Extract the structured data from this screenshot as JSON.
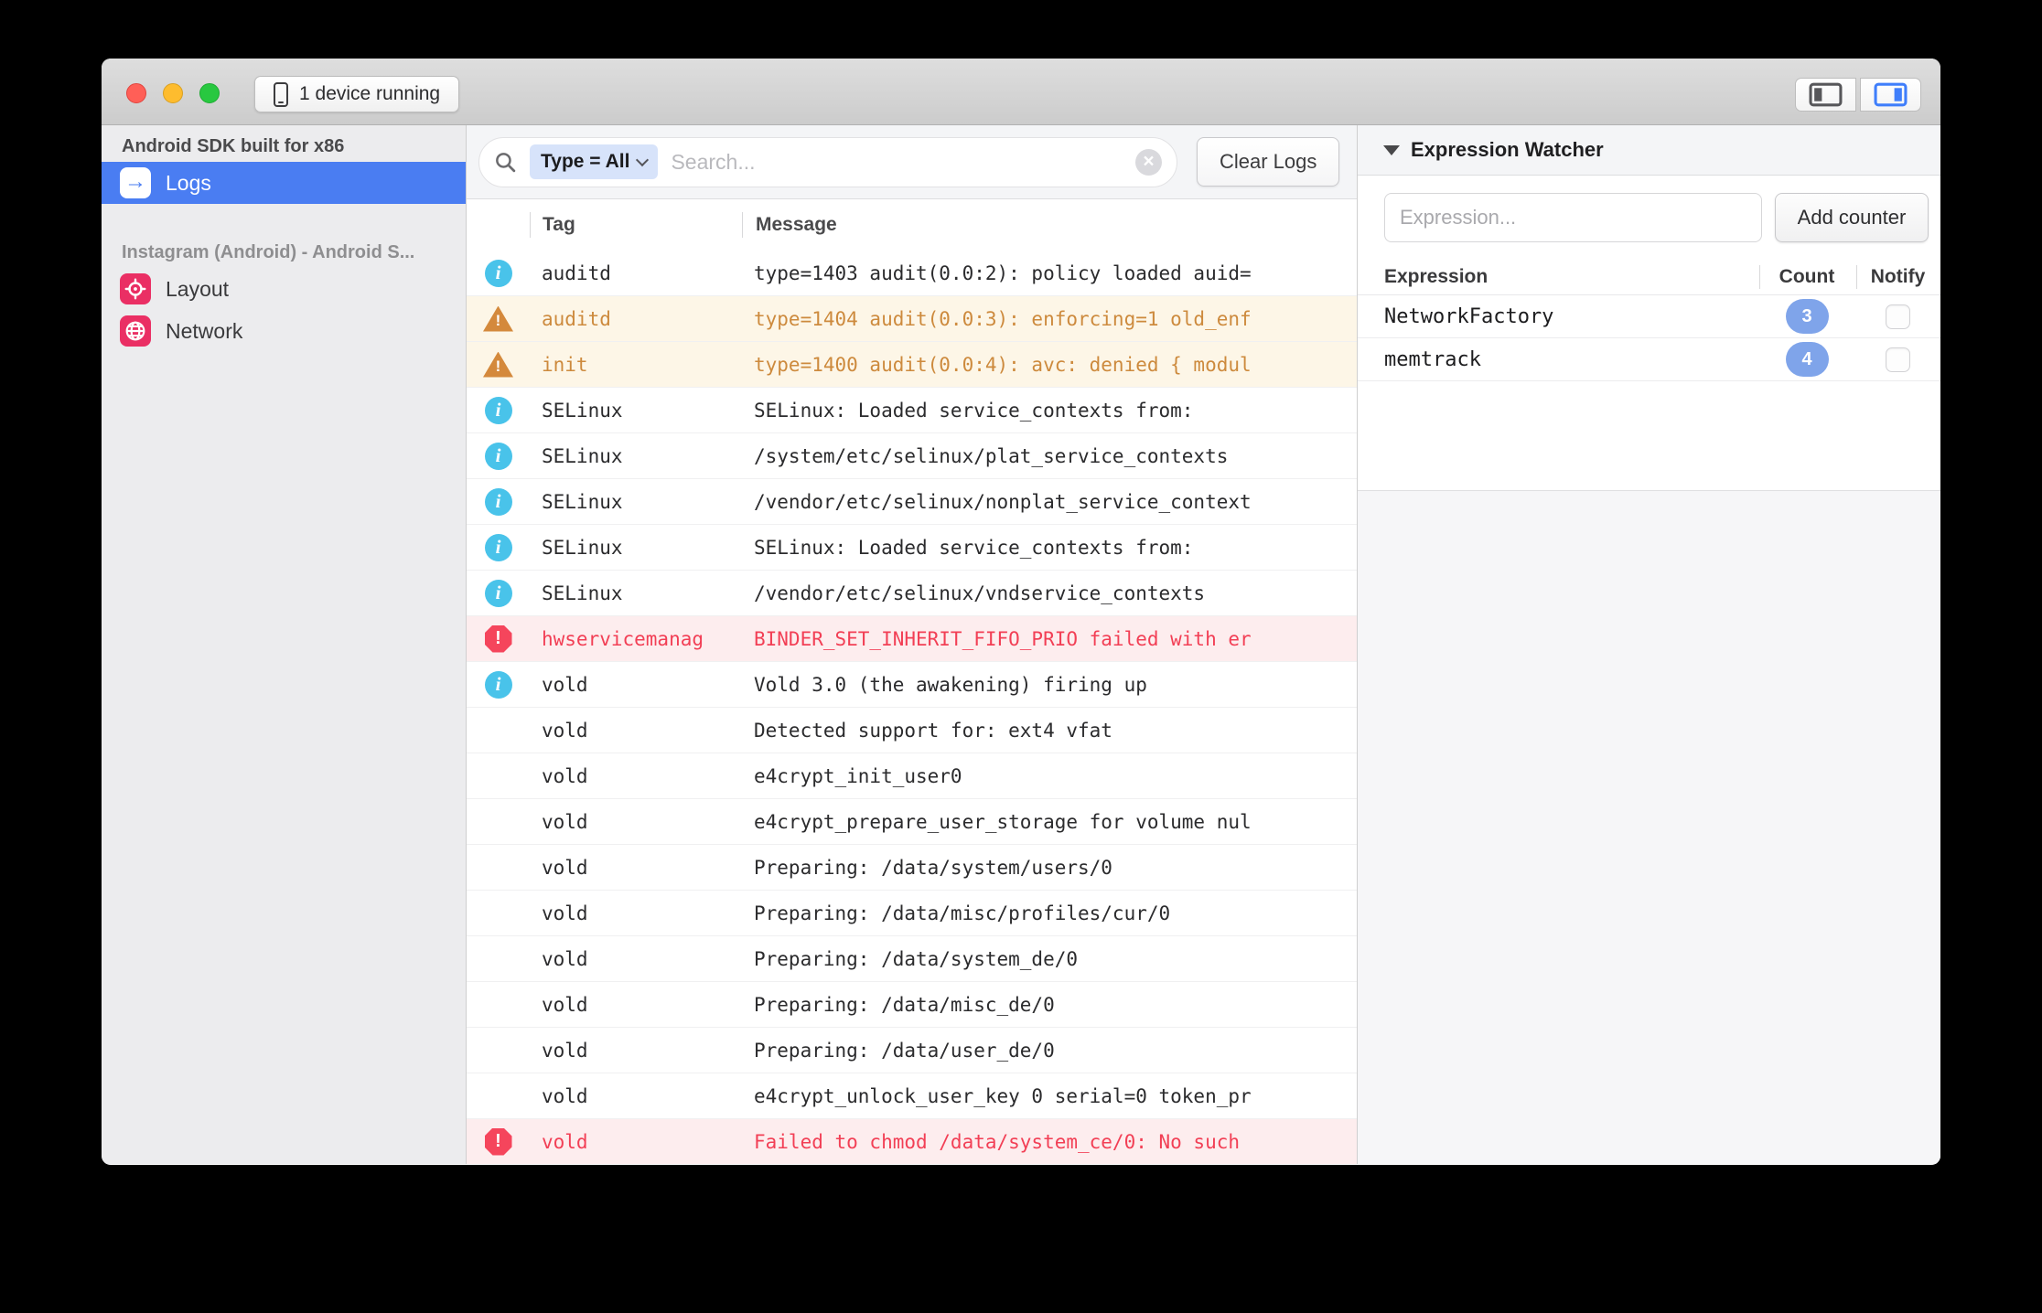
{
  "titlebar": {
    "device_button_label": "1 device running"
  },
  "sidebar": {
    "device_header": "Android SDK built for x86",
    "logs_label": "Logs",
    "app_header": "Instagram (Android) - Android S...",
    "layout_label": "Layout",
    "network_label": "Network"
  },
  "toolbar": {
    "filter_chip_label": "Type = All",
    "search_placeholder": "Search...",
    "clear_logs_label": "Clear Logs"
  },
  "log_table": {
    "columns": {
      "tag": "Tag",
      "message": "Message"
    },
    "rows": [
      {
        "level": "info",
        "tag": "auditd",
        "message": "type=1403 audit(0.0:2): policy loaded auid="
      },
      {
        "level": "warn",
        "tag": "auditd",
        "message": "type=1404 audit(0.0:3): enforcing=1 old_enf"
      },
      {
        "level": "warn",
        "tag": "init",
        "message": "type=1400 audit(0.0:4): avc: denied { modul"
      },
      {
        "level": "info",
        "tag": "SELinux",
        "message": "SELinux: Loaded service_contexts from:"
      },
      {
        "level": "info",
        "tag": "SELinux",
        "message": "/system/etc/selinux/plat_service_contexts"
      },
      {
        "level": "info",
        "tag": "SELinux",
        "message": "/vendor/etc/selinux/nonplat_service_context"
      },
      {
        "level": "info",
        "tag": "SELinux",
        "message": "SELinux: Loaded service_contexts from:"
      },
      {
        "level": "info",
        "tag": "SELinux",
        "message": "/vendor/etc/selinux/vndservice_contexts"
      },
      {
        "level": "error",
        "tag": "hwservicemanag",
        "message": "BINDER_SET_INHERIT_FIFO_PRIO failed with er"
      },
      {
        "level": "info",
        "tag": "vold",
        "message": "Vold 3.0 (the awakening) firing up"
      },
      {
        "level": "none",
        "tag": "vold",
        "message": "Detected support for: ext4 vfat"
      },
      {
        "level": "none",
        "tag": "vold",
        "message": "e4crypt_init_user0"
      },
      {
        "level": "none",
        "tag": "vold",
        "message": "e4crypt_prepare_user_storage for volume nul"
      },
      {
        "level": "none",
        "tag": "vold",
        "message": "Preparing: /data/system/users/0"
      },
      {
        "level": "none",
        "tag": "vold",
        "message": "Preparing: /data/misc/profiles/cur/0"
      },
      {
        "level": "none",
        "tag": "vold",
        "message": "Preparing: /data/system_de/0"
      },
      {
        "level": "none",
        "tag": "vold",
        "message": "Preparing: /data/misc_de/0"
      },
      {
        "level": "none",
        "tag": "vold",
        "message": "Preparing: /data/user_de/0"
      },
      {
        "level": "none",
        "tag": "vold",
        "message": "e4crypt_unlock_user_key 0 serial=0 token_pr"
      },
      {
        "level": "error",
        "tag": "vold",
        "message": "Failed to chmod /data/system_ce/0: No such"
      }
    ]
  },
  "watcher": {
    "title": "Expression Watcher",
    "input_placeholder": "Expression...",
    "add_button_label": "Add counter",
    "columns": {
      "expression": "Expression",
      "count": "Count",
      "notify": "Notify"
    },
    "rows": [
      {
        "expression": "NetworkFactory",
        "count": "3",
        "notify": false
      },
      {
        "expression": "memtrack",
        "count": "4",
        "notify": false
      }
    ]
  },
  "colors": {
    "selection_blue": "#4a7df2",
    "plugin_pink": "#ea2f64",
    "info_blue": "#49c3ea",
    "warn_orange": "#cd8a3d",
    "warn_bg": "#fdf6e7",
    "error_red": "#f23f55",
    "error_bg": "#fdedee",
    "badge_blue": "#7fa4ea"
  }
}
